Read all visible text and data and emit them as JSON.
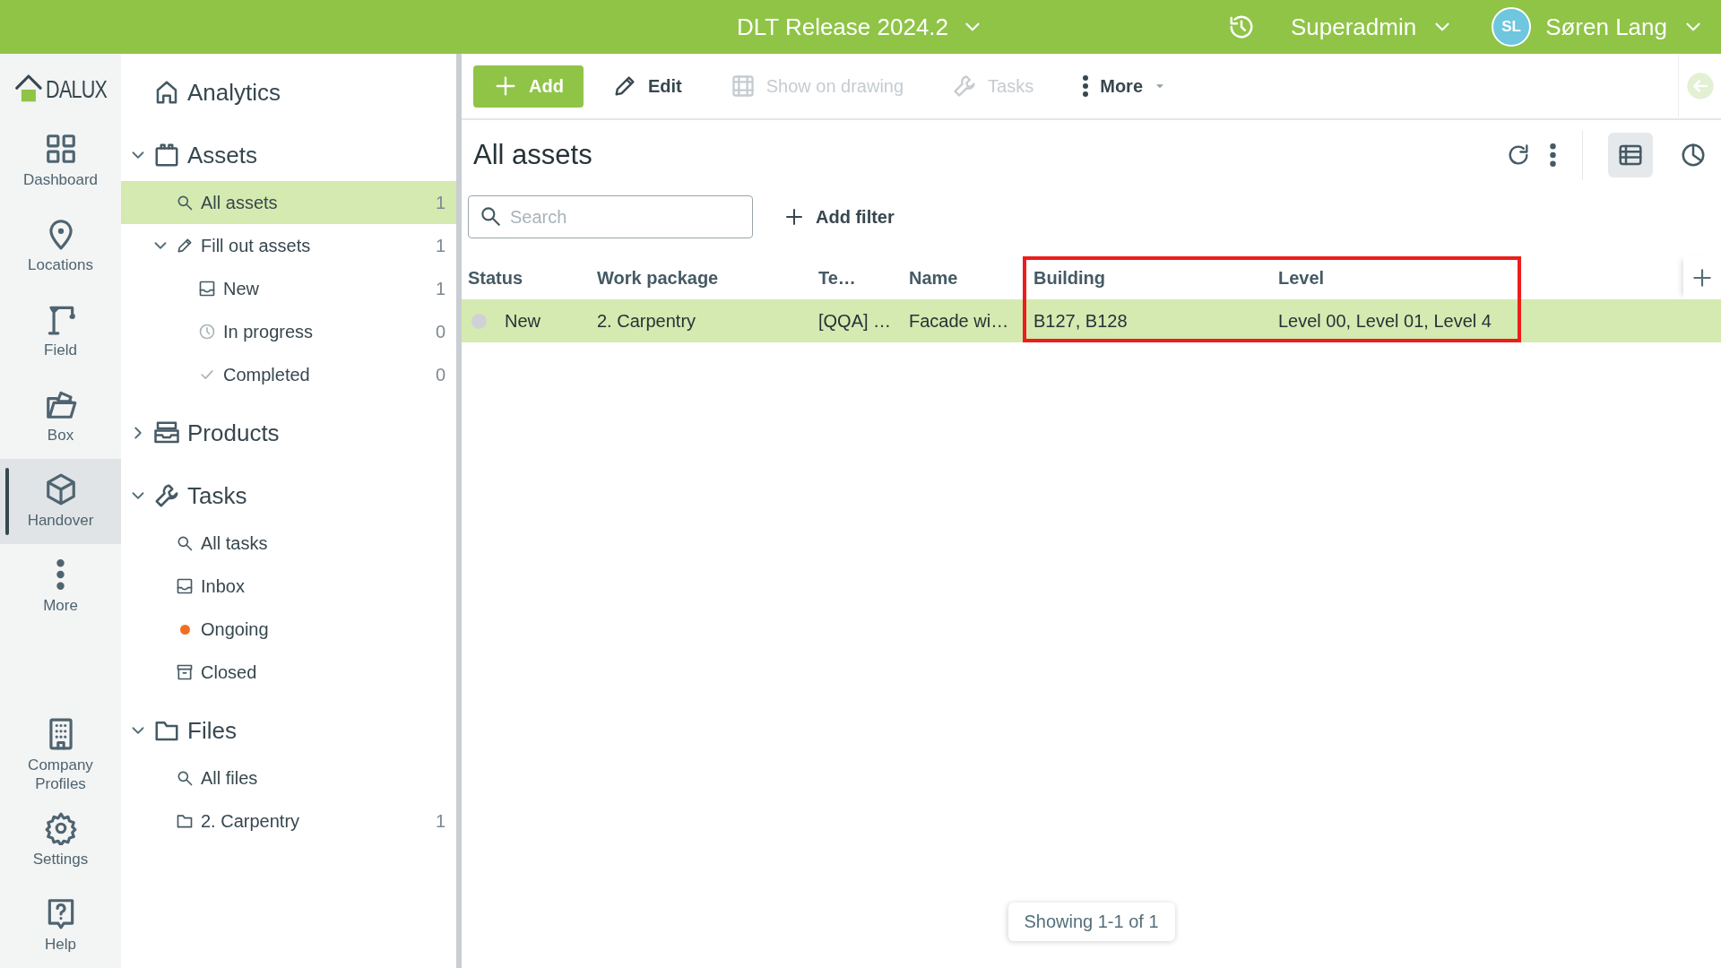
{
  "topbar": {
    "project": "DLT Release 2024.2",
    "role": "Superadmin",
    "user": {
      "initials": "SL",
      "name": "Søren Lang"
    }
  },
  "rail": {
    "logo": "DALUX",
    "items": [
      {
        "label": "Dashboard",
        "selected": false
      },
      {
        "label": "Locations",
        "selected": false
      },
      {
        "label": "Field",
        "selected": false
      },
      {
        "label": "Box",
        "selected": false
      },
      {
        "label": "Handover",
        "selected": true
      },
      {
        "label": "More",
        "selected": false
      }
    ],
    "bottom_items": [
      {
        "label": "Company Profiles"
      },
      {
        "label": "Settings"
      },
      {
        "label": "Help"
      }
    ]
  },
  "nav": [
    {
      "label": "Analytics"
    },
    {
      "label": "Assets",
      "expanded": true,
      "children": [
        {
          "label": "All assets",
          "count": "1",
          "selected": true
        },
        {
          "label": "Fill out assets",
          "count": "1",
          "selected": false,
          "expanded": true,
          "children": [
            {
              "label": "New",
              "count": "1",
              "selected": false
            },
            {
              "label": "In progress",
              "count": "0",
              "selected": false
            },
            {
              "label": "Completed",
              "count": "0",
              "selected": false
            }
          ]
        }
      ]
    },
    {
      "label": "Products",
      "expanded": false
    },
    {
      "label": "Tasks",
      "expanded": true,
      "children": [
        {
          "label": "All tasks",
          "selected": false
        },
        {
          "label": "Inbox",
          "selected": false
        },
        {
          "label": "Ongoing",
          "selected": false,
          "color": "#f07022"
        },
        {
          "label": "Closed",
          "selected": false
        }
      ]
    },
    {
      "label": "Files",
      "expanded": true,
      "children": [
        {
          "label": "All files",
          "selected": false
        },
        {
          "label": "2. Carpentry",
          "count": "1",
          "selected": false
        }
      ]
    }
  ],
  "toolbar": [
    {
      "label": "Add",
      "kind": "primary",
      "disabled": false
    },
    {
      "label": "Edit",
      "kind": "plain",
      "disabled": false
    },
    {
      "label": "Show on drawing",
      "kind": "plain",
      "disabled": true
    },
    {
      "label": "Tasks",
      "kind": "plain",
      "disabled": true
    },
    {
      "label": "More",
      "kind": "menu",
      "disabled": false
    }
  ],
  "back_disabled": true,
  "page_title": "All assets",
  "views": [
    {
      "selected": true
    },
    {
      "selected": false
    }
  ],
  "search": {
    "placeholder": "Search"
  },
  "add_filter": "Add filter",
  "table": {
    "columns": [
      {
        "label": "Status"
      },
      {
        "label": "Work package"
      },
      {
        "label": "Te…"
      },
      {
        "label": "Name"
      },
      {
        "label": "Building",
        "highlighted": true
      },
      {
        "label": "Level",
        "highlighted": true
      }
    ],
    "rows": [
      {
        "selected": true,
        "cells": [
          "New",
          "2. Carpentry",
          "[QQA] …",
          "Facade wi…",
          "B127, B128",
          "Level 00, Level 01, Level 4"
        ]
      }
    ]
  },
  "footer": "Showing 1-1 of 1"
}
